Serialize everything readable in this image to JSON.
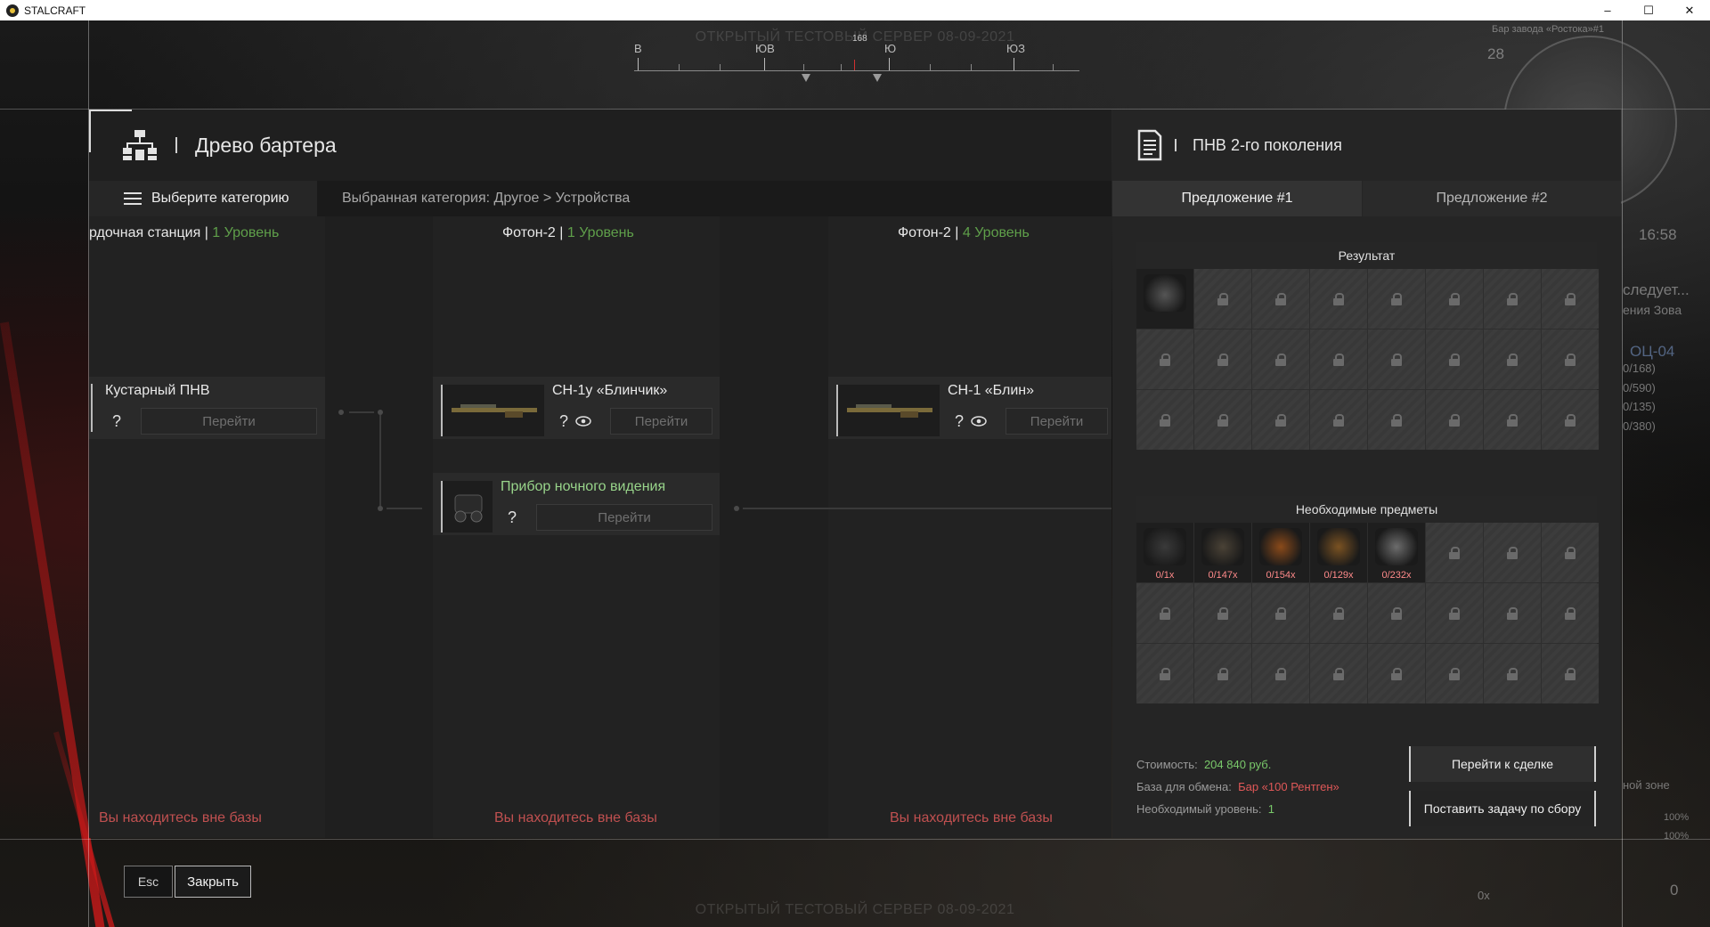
{
  "window": {
    "title": "STALCRAFT",
    "controls": [
      "–",
      "☐",
      "✕"
    ]
  },
  "hud": {
    "server_banner": "ОТКРЫТЫЙ ТЕСТОВЫЙ СЕРВЕР 08-09-2021",
    "compass": {
      "heading": "168",
      "labels": [
        "В",
        "ЮВ",
        "Ю",
        "ЮЗ"
      ]
    },
    "top_right_label": "Бар завода «Ростока»#1",
    "top_right_num": "28",
    "clock": "16:58",
    "quest_text_1": "следует...",
    "quest_text_2": "ения Зова",
    "weapon_name": "ОЦ-04",
    "ammo_lines": [
      "0/168)",
      "0/590)",
      "0/135)",
      "0/380)"
    ],
    "zone_text": "ной зоне",
    "stat_1": "100%",
    "stat_2": "100%",
    "counter_left": "0x",
    "counter_right": "0"
  },
  "barter": {
    "title": "Древо бартера",
    "category_button": "Выберите категорию",
    "category_path": "Выбранная категория: Другое > Устройства",
    "columns": [
      {
        "name": "рдочная станция",
        "level": "1 Уровень",
        "footer": "Вы находитесь вне базы"
      },
      {
        "name": "Фотон-2",
        "level": "1 Уровень",
        "footer": "Вы находитесь вне базы"
      },
      {
        "name": "Фотон-2",
        "level": "4 Уровень",
        "footer": "Вы находитесь вне базы"
      }
    ],
    "nodes": {
      "kustarny": {
        "name": "Кустарный ПНВ",
        "q": "?",
        "go": "Перейти"
      },
      "sn1u": {
        "name": "СН-1у «Блинчик»",
        "q": "?",
        "go": "Перейти"
      },
      "pnv": {
        "name": "Прибор ночного видения",
        "q": "?",
        "go": "Перейти"
      },
      "sn1": {
        "name": "СН-1 «Блин»",
        "q": "?",
        "go": "Перейти"
      }
    }
  },
  "offer": {
    "title": "ПНВ 2-го поколения",
    "tabs": [
      "Предложение #1",
      "Предложение #2"
    ],
    "result_title": "Результат",
    "required_title": "Необходимые предметы",
    "required_items": [
      {
        "name": "night-vision-device",
        "qty": "0/1x",
        "color": "#3a3a3a"
      },
      {
        "name": "wire-tool",
        "qty": "0/147x",
        "color": "#4a4236"
      },
      {
        "name": "orange-fern",
        "qty": "0/154x",
        "color": "#8a4a1a"
      },
      {
        "name": "orange-case",
        "qty": "0/129x",
        "color": "#7a5222"
      },
      {
        "name": "ore-chunk",
        "qty": "0/232x",
        "color": "#6c6c6c"
      }
    ],
    "cost_label": "Стоимость:",
    "cost_value": "204 840 руб.",
    "base_label": "База для обмена:",
    "base_value": "Бар «100 Рентген»",
    "level_label": "Необходимый уровень:",
    "level_value": "1",
    "go_deal": "Перейти к сделке",
    "set_task": "Поставить задачу по сбору"
  },
  "footer": {
    "esc": "Esc",
    "close": "Закрыть"
  }
}
